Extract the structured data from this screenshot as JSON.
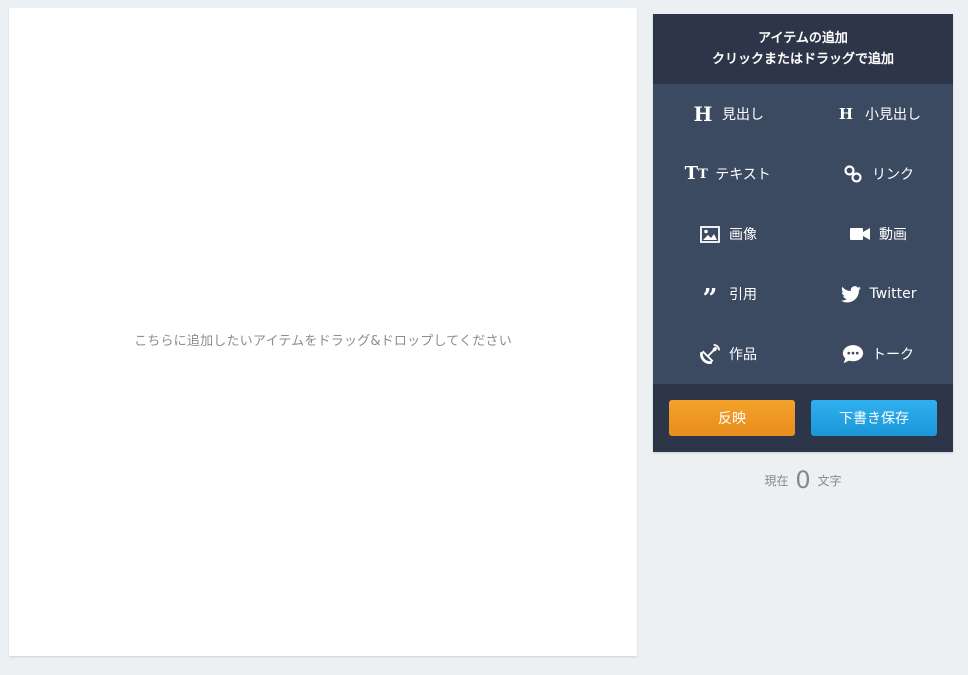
{
  "canvas": {
    "drop_hint": "こちらに追加したいアイテムをドラッグ&ドロップしてください"
  },
  "panel": {
    "title_line1": "アイテムの追加",
    "title_line2": "クリックまたはドラッグで追加",
    "items": [
      {
        "label": "見出し",
        "icon": "heading-icon"
      },
      {
        "label": "小見出し",
        "icon": "subheading-icon"
      },
      {
        "label": "テキスト",
        "icon": "text-icon"
      },
      {
        "label": "リンク",
        "icon": "link-icon"
      },
      {
        "label": "画像",
        "icon": "image-icon"
      },
      {
        "label": "動画",
        "icon": "video-camera-icon"
      },
      {
        "label": "引用",
        "icon": "quote-icon"
      },
      {
        "label": "Twitter",
        "icon": "twitter-bird-icon"
      },
      {
        "label": "作品",
        "icon": "satellite-dish-icon"
      },
      {
        "label": "トーク",
        "icon": "speech-bubble-icon"
      }
    ],
    "apply_label": "反映",
    "draft_label": "下書き保存",
    "colors": {
      "panel_bg": "#3c4a61",
      "header_bg": "#2d3649",
      "apply": "#ef9a24",
      "draft": "#22a3e4"
    }
  },
  "counter": {
    "prefix": "現在",
    "count": "0",
    "suffix": "文字"
  }
}
